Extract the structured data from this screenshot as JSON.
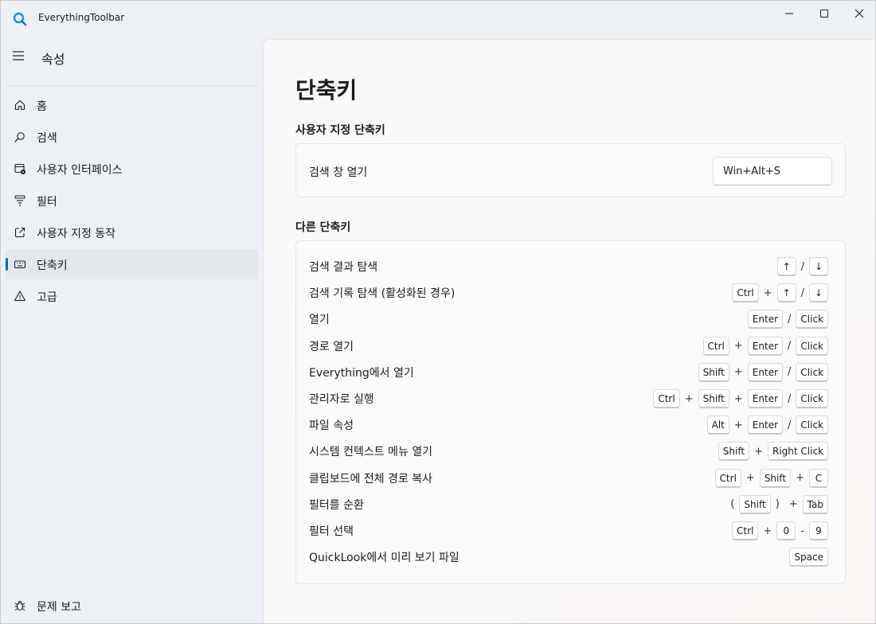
{
  "window": {
    "title": "EverythingToolbar"
  },
  "sidebar": {
    "title": "속성",
    "items": [
      {
        "label": "홈",
        "icon": "home-icon"
      },
      {
        "label": "검색",
        "icon": "search-icon"
      },
      {
        "label": "사용자 인터페이스",
        "icon": "ui-settings-icon"
      },
      {
        "label": "필터",
        "icon": "filter-icon"
      },
      {
        "label": "사용자 지정 동작",
        "icon": "open-external-icon"
      },
      {
        "label": "단축키",
        "icon": "keyboard-icon",
        "selected": true
      },
      {
        "label": "고급",
        "icon": "warning-icon"
      }
    ],
    "footer": {
      "label": "문제 보고",
      "icon": "bug-icon"
    }
  },
  "main": {
    "title": "단축키",
    "custom_section": {
      "title": "사용자 지정 단축키",
      "label": "검색 창 열기",
      "value": "Win+Alt+S"
    },
    "other_section": {
      "title": "다른 단축키",
      "rows": [
        {
          "label": "검색 결과 탐색",
          "keys": [
            "↑",
            "/",
            "↓"
          ]
        },
        {
          "label": "검색 기록 탐색 (활성화된 경우)",
          "keys": [
            "Ctrl",
            "+",
            "↑",
            "/",
            "↓"
          ]
        },
        {
          "label": "열기",
          "keys": [
            "Enter",
            "/",
            "Click"
          ]
        },
        {
          "label": "경로 열기",
          "keys": [
            "Ctrl",
            "+",
            "Enter",
            "/",
            "Click"
          ]
        },
        {
          "label": "Everything에서 열기",
          "keys": [
            "Shift",
            "+",
            "Enter",
            "/",
            "Click"
          ]
        },
        {
          "label": "관리자로 실행",
          "keys": [
            "Ctrl",
            "+",
            "Shift",
            "+",
            "Enter",
            "/",
            "Click"
          ]
        },
        {
          "label": "파일 속성",
          "keys": [
            "Alt",
            "+",
            "Enter",
            "/",
            "Click"
          ]
        },
        {
          "label": "시스템 컨텍스트 메뉴 열기",
          "keys": [
            "Shift",
            "+",
            "Right Click"
          ]
        },
        {
          "label": "클립보드에 전체 경로 복사",
          "keys": [
            "Ctrl",
            "+",
            "Shift",
            "+",
            "C"
          ]
        },
        {
          "label": "필터를 순환",
          "keys": [
            "(",
            "Shift",
            ")",
            "+",
            "Tab"
          ]
        },
        {
          "label": "필터 선택",
          "keys": [
            "Ctrl",
            "+",
            "0",
            "-",
            "9"
          ]
        },
        {
          "label": "QuickLook에서 미리 보기 파일",
          "keys": [
            "Space"
          ]
        }
      ]
    }
  }
}
